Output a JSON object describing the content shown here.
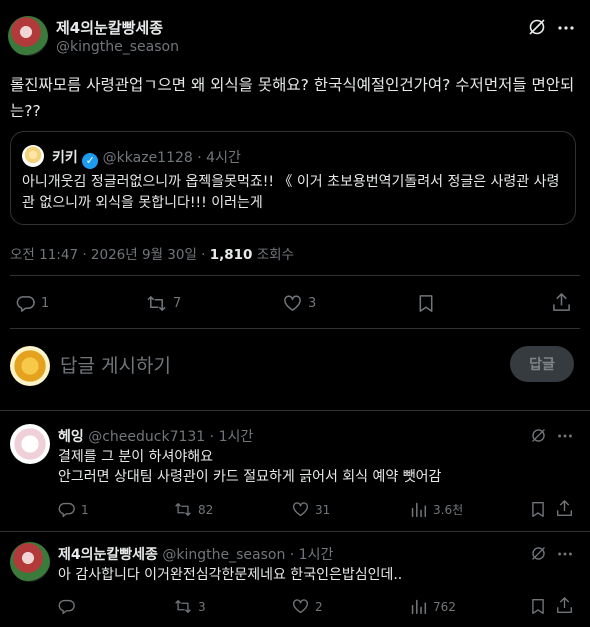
{
  "main_tweet": {
    "display_name": "제4의눈칼빵세종",
    "handle": "@kingthe_season",
    "text": "롤진짜모름 사령관업ㄱ으면 왜 외식을 못해요? 한국식예절인건가여? 수저먼저들 면안되는??",
    "quoted": {
      "display_name": "키키",
      "handle": "@kkaze1128",
      "time": "4시간",
      "text": "아니개웃김 정글러없으니까 옵젝을못먹죠!! 《 이거 초보용번역기돌려서 정글은 사령관 사령관 없으니까 외식을 못합니다!!! 이러는게"
    },
    "meta_time": "오전 11:47 · 2026년 9월 30일 · ",
    "views_count": "1,810",
    "views_label": "조회수",
    "replies": "1",
    "retweets": "7",
    "likes": "3"
  },
  "compose": {
    "placeholder": "답글 게시하기",
    "button": "답글"
  },
  "replies": [
    {
      "display_name": "헤잉",
      "handle": "@cheeduck7131",
      "time": "· 1시간",
      "line1": "결제를 그 분이 하셔야해요",
      "line2": "안그러면 상대팀 사령관이 카드 절묘하게 긁어서 회식 예약 뺏어감",
      "replies": "1",
      "retweets": "82",
      "likes": "31",
      "views": "3.6천"
    },
    {
      "display_name": "제4의눈칼빵세종",
      "handle": "@kingthe_season",
      "time": "· 1시간",
      "line1": "아 감사합니다 이거완전심각한문제네요 한국인은밥심인데..",
      "replies": "",
      "retweets": "3",
      "likes": "2",
      "views": "762"
    }
  ]
}
